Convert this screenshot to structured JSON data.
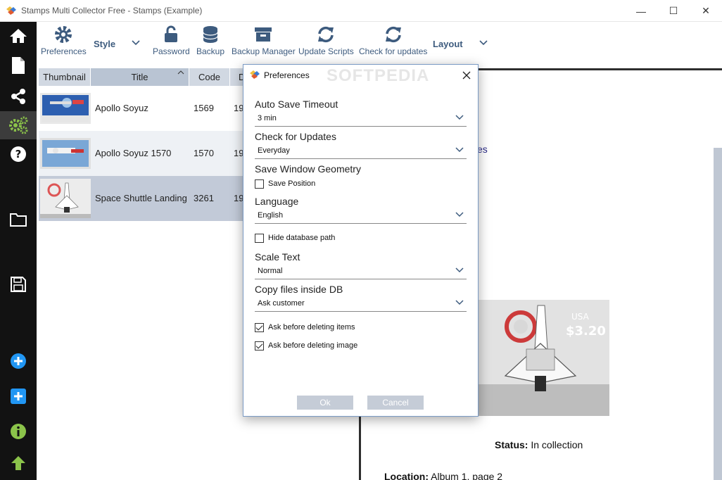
{
  "window": {
    "title": "Stamps Multi Collector Free - Stamps (Example)",
    "minimize": "—",
    "maximize": "☐",
    "close": "✕"
  },
  "sidebar": {
    "items": [
      {
        "icon": "home-icon"
      },
      {
        "icon": "document-icon"
      },
      {
        "icon": "share-icon"
      },
      {
        "icon": "gears-icon",
        "active": true
      },
      {
        "icon": "help-icon"
      },
      {
        "icon": "folder-icon"
      },
      {
        "icon": "save-icon"
      },
      {
        "icon": "add-circle-icon"
      },
      {
        "icon": "add-square-icon"
      },
      {
        "icon": "info-icon"
      },
      {
        "icon": "up-arrow-icon"
      }
    ]
  },
  "toolbar": {
    "preferences": "Preferences",
    "style": "Style",
    "password": "Password",
    "backup": "Backup",
    "backup_manager": "Backup Manager",
    "update_scripts": "Update Scripts",
    "check_updates": "Check for updates",
    "layout": "Layout"
  },
  "table": {
    "columns": [
      "Thumbnail",
      "Title",
      "Code",
      "D"
    ],
    "rows": [
      {
        "title": "Apollo Soyuz",
        "code": "1569",
        "date": "19"
      },
      {
        "title": "Apollo Soyuz 1570",
        "code": "1570",
        "date": "19"
      },
      {
        "title": "Space Shuttle Landing",
        "code": "3261",
        "date": "19"
      }
    ]
  },
  "detail": {
    "partial_text": "es",
    "stamp_country": "USA",
    "stamp_value": "$3.20",
    "status_label": "Status:",
    "status_value": "In collection",
    "location_label": "Location:",
    "location_value": "Album 1, page 2"
  },
  "dialog": {
    "title": "Preferences",
    "watermark": "SOFTPEDIA",
    "auto_save_label": "Auto Save Timeout",
    "auto_save_value": "3 min",
    "check_updates_label": "Check for Updates",
    "check_updates_value": "Everyday",
    "geometry_label": "Save Window Geometry",
    "save_position_label": "Save Position",
    "save_position_checked": false,
    "language_label": "Language",
    "language_value": "English",
    "hide_db_path_label": "Hide database path",
    "hide_db_path_checked": false,
    "scale_text_label": "Scale Text",
    "scale_text_value": "Normal",
    "copy_files_label": "Copy files inside DB",
    "copy_files_value": "Ask customer",
    "ask_items_label": "Ask before deleting items",
    "ask_items_checked": true,
    "ask_image_label": "Ask before deleting image",
    "ask_image_checked": true,
    "ok_label": "Ok",
    "cancel_label": "Cancel"
  },
  "colors": {
    "sidebar_bg": "#121212",
    "accent_green": "#8bc34a",
    "accent_blue": "#2196f3",
    "toolbar_text": "#3d5b7e",
    "header_bg": "#d1d8e2",
    "selected_row": "#c2cad8"
  }
}
